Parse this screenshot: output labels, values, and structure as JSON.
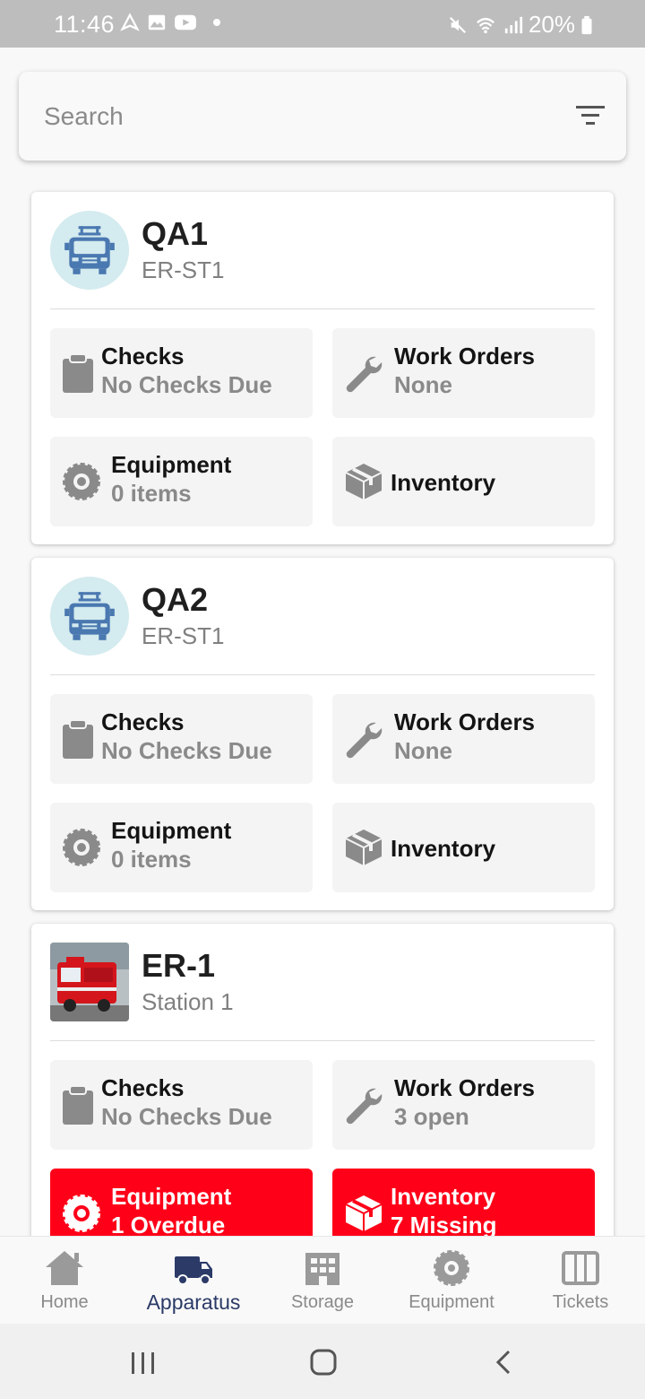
{
  "status_bar": {
    "time": "11:46",
    "battery": "20%"
  },
  "search": {
    "placeholder": "Search"
  },
  "apparatus": [
    {
      "name": "QA1",
      "station": "ER-ST1",
      "checks_label": "Checks",
      "checks_value": "No Checks Due",
      "work_orders_label": "Work Orders",
      "work_orders_value": "None",
      "equipment_label": "Equipment",
      "equipment_value": "0 items",
      "inventory_label": "Inventory",
      "inventory_value": ""
    },
    {
      "name": "QA2",
      "station": "ER-ST1",
      "checks_label": "Checks",
      "checks_value": "No Checks Due",
      "work_orders_label": "Work Orders",
      "work_orders_value": "None",
      "equipment_label": "Equipment",
      "equipment_value": "0 items",
      "inventory_label": "Inventory",
      "inventory_value": ""
    },
    {
      "name": "ER-1",
      "station": "Station 1",
      "checks_label": "Checks",
      "checks_value": "No Checks Due",
      "work_orders_label": "Work Orders",
      "work_orders_value": "3 open",
      "equipment_label": "Equipment",
      "equipment_value": "1 Overdue",
      "inventory_label": "Inventory",
      "inventory_value": "7 Missing"
    }
  ],
  "bottom_nav": {
    "items": [
      {
        "label": "Home",
        "icon": "home-icon"
      },
      {
        "label": "Apparatus",
        "icon": "truck-icon"
      },
      {
        "label": "Storage",
        "icon": "building-icon"
      },
      {
        "label": "Equipment",
        "icon": "saw-blade-icon"
      },
      {
        "label": "Tickets",
        "icon": "columns-icon"
      }
    ],
    "active": "Apparatus"
  },
  "colors": {
    "alert": "#ff0019",
    "active_nav": "#2b3a67",
    "avatar_bg": "#d4ebef",
    "icon_blue": "#4a78b0"
  }
}
